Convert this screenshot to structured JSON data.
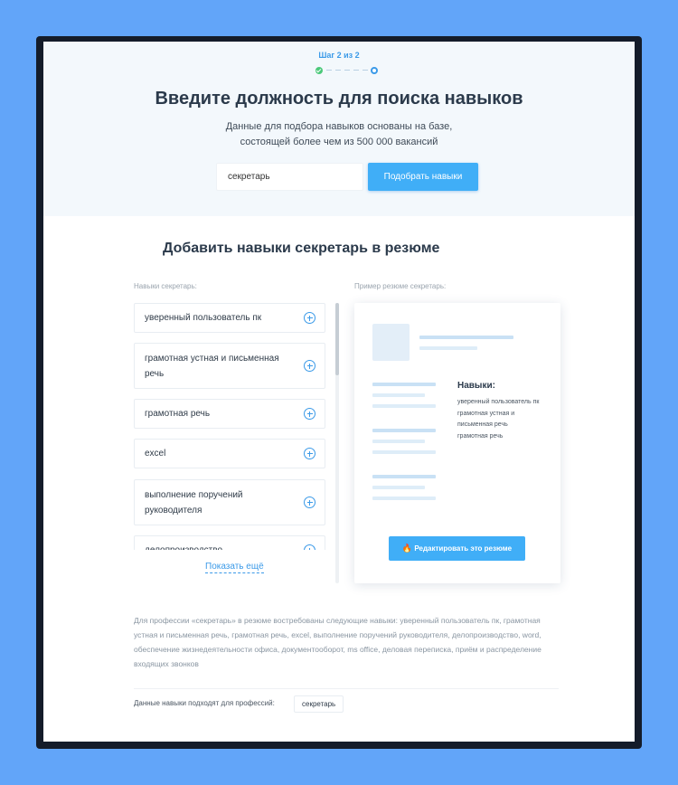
{
  "header": {
    "step_label": "Шаг 2 из 2",
    "title": "Введите должность для поиска навыков",
    "subtitle_line1": "Данные для подбора навыков основаны на базе,",
    "subtitle_line2": "состоящей более чем из 500 000 вакансий",
    "search_value": "секретарь",
    "search_button": "Подобрать навыки"
  },
  "section": {
    "title": "Добавить навыки секретарь в резюме",
    "skills_label": "Навыки секретарь:",
    "example_label": "Пример резюме секретарь:",
    "skills": [
      {
        "line1": "уверенный пользователь пк",
        "line2": ""
      },
      {
        "line1": "грамотная устная и письменная",
        "line2": "речь"
      },
      {
        "line1": "грамотная речь",
        "line2": ""
      },
      {
        "line1": "excel",
        "line2": ""
      },
      {
        "line1": "выполнение поручений",
        "line2": "руководителя"
      },
      {
        "line1": "делопроизводство",
        "line2": ""
      }
    ],
    "show_more": "Показать ещё"
  },
  "resume": {
    "skills_title": "Навыки:",
    "skill_lines": [
      "уверенный пользователь пк",
      "грамотная устная и",
      "письменная речь",
      "грамотная речь"
    ],
    "edit_button": "Редактировать это резюме",
    "edit_icon": "flame-icon"
  },
  "footer": {
    "description": "Для профессии «секретарь» в резюме востребованы следующие навыки: уверенный пользователь пк, грамотная устная и письменная речь, грамотная речь, excel, выполнение поручений руководителя, делопроизводство, word, обеспечение жизнедеятельности офиса, документооборот, ms office, деловая переписка, приём и распределение входящих звонков",
    "professions_label": "Данные навыки подходят для профессий:",
    "profession_tag": "секретарь"
  },
  "colors": {
    "accent": "#40aef7",
    "success": "#4cc97a",
    "hero_bg": "#f3f8fc",
    "outer_bg": "#62a5f9"
  }
}
